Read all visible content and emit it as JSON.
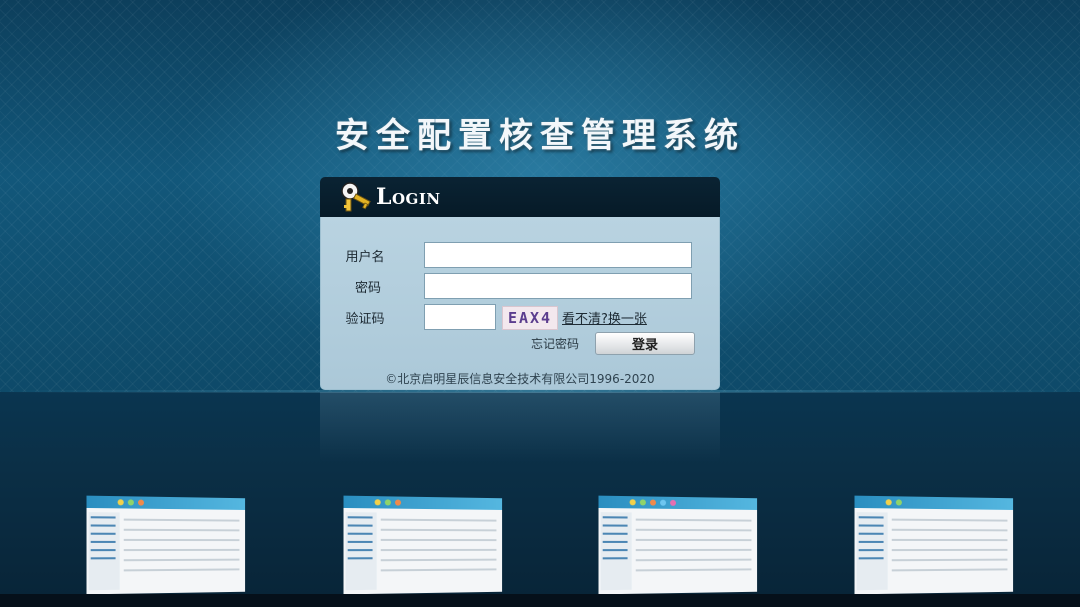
{
  "app": {
    "title": "安全配置核查管理系统"
  },
  "login": {
    "heading": "Login",
    "username_label": "用户名",
    "password_label": "密码",
    "captcha_label": "验证码",
    "captcha_text": "EAX4",
    "refresh_captcha": "看不清?换一张",
    "forgot_password": "忘记密码",
    "submit_label": "登录",
    "username_value": "",
    "password_value": "",
    "captcha_value": ""
  },
  "footer": {
    "copyright": "©北京启明星辰信息安全技术有限公司1996-2020"
  },
  "colors": {
    "background": "#0f4865",
    "panel": "#b9d3e1",
    "header": "#061a27"
  },
  "icons": {
    "login_icon": "key-icon"
  }
}
